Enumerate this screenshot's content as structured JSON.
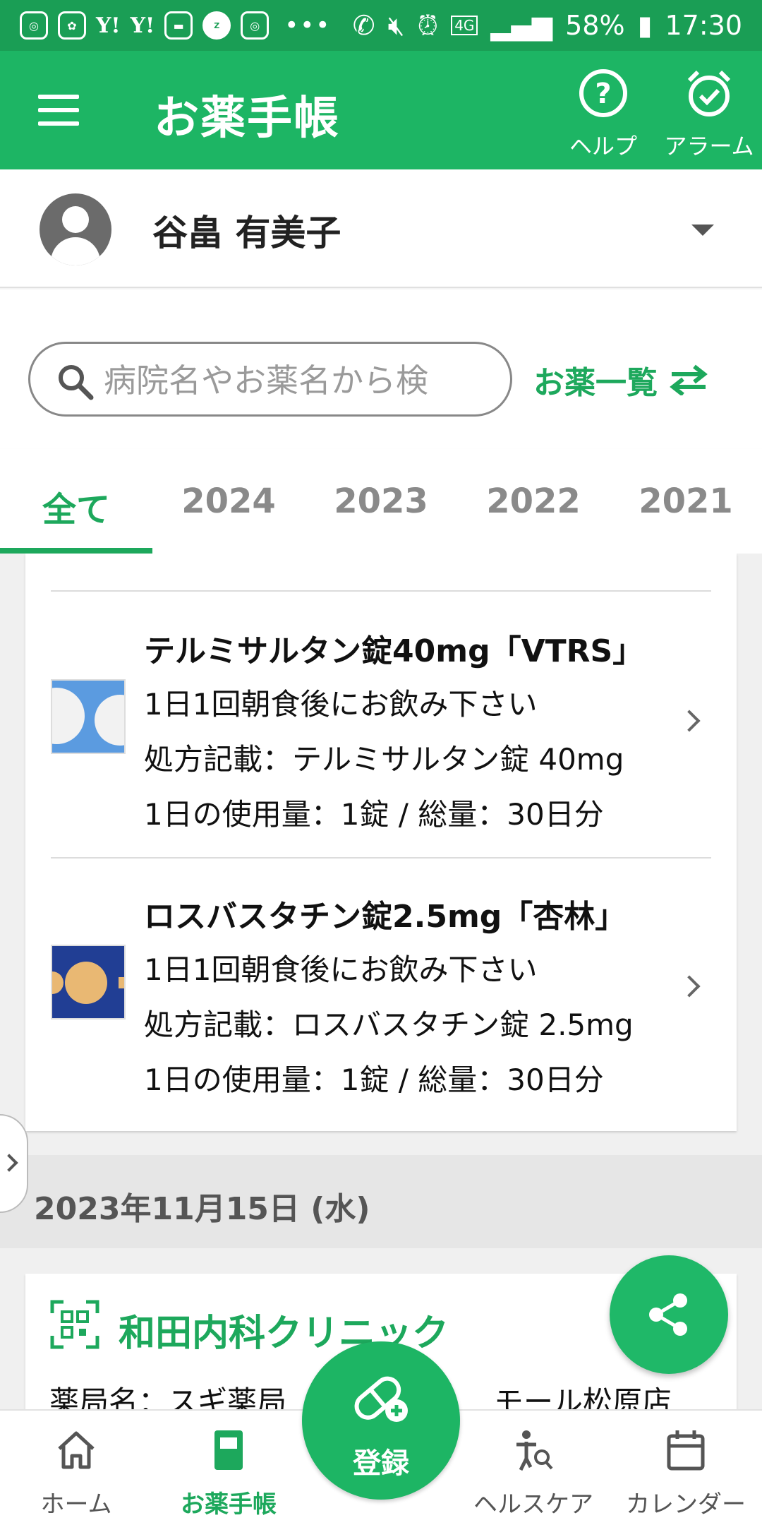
{
  "status_bar": {
    "battery": "58%",
    "time": "17:30",
    "network": "4G"
  },
  "app_bar": {
    "title": "お薬手帳",
    "help_label": "ヘルプ",
    "alarm_label": "アラーム"
  },
  "profile": {
    "name": "谷畠 有美子"
  },
  "search": {
    "placeholder": "病院名やお薬名から検",
    "med_list_label": "お薬一覧"
  },
  "tabs": [
    "全て",
    "2024",
    "2023",
    "2022",
    "2021"
  ],
  "medications": [
    {
      "name": "テルミサルタン錠40mg「VTRS」",
      "usage": "1日1回朝食後にお飲み下さい",
      "prescription": "処方記載：テルミサルタン錠 40mg",
      "dosage": "1日の使用量：1錠 / 総量：30日分"
    },
    {
      "name": "ロスバスタチン錠2.5mg「杏林」",
      "usage": "1日1回朝食後にお飲み下さい",
      "prescription": "処方記載：ロスバスタチン錠 2.5mg",
      "dosage": "1日の使用量：1錠 / 総量：30日分"
    }
  ],
  "date_header": "2023年11月15日 (水)",
  "clinic": {
    "name": "和田内科クリニック",
    "pharmacy": "薬局名：スギ薬局　　　　　　　モール松原店"
  },
  "register_label": "登録",
  "bottom_nav": {
    "home": "ホーム",
    "notebook": "お薬手帳",
    "healthcare": "ヘルスケア",
    "calendar": "カレンダー"
  },
  "colors": {
    "primary": "#1db564",
    "status_bar": "#1a9e55",
    "accent_text": "#1da85c"
  }
}
